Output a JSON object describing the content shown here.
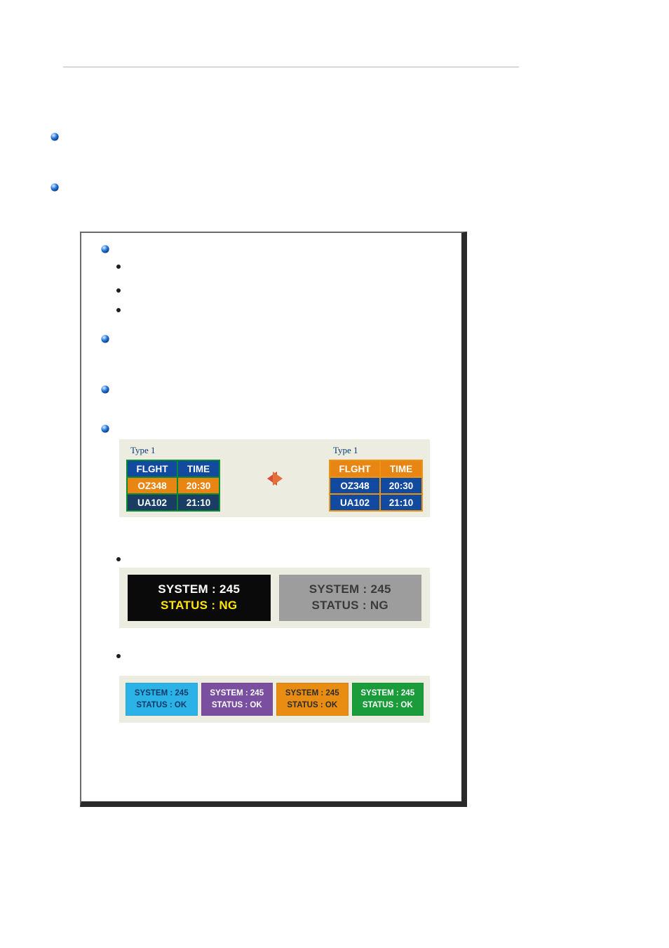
{
  "figure1": {
    "label_left": "Type 1",
    "label_right": "Type 1",
    "header_flight": "FLGHT",
    "header_time": "TIME",
    "rows": [
      {
        "flight": "OZ348",
        "time": "20:30"
      },
      {
        "flight": "UA102",
        "time": "21:10"
      }
    ]
  },
  "figure2": {
    "system_line": "SYSTEM : 245",
    "status_line": "STATUS : NG"
  },
  "figure3": {
    "system_line": "SYSTEM : 245",
    "status_line": "STATUS : OK"
  }
}
